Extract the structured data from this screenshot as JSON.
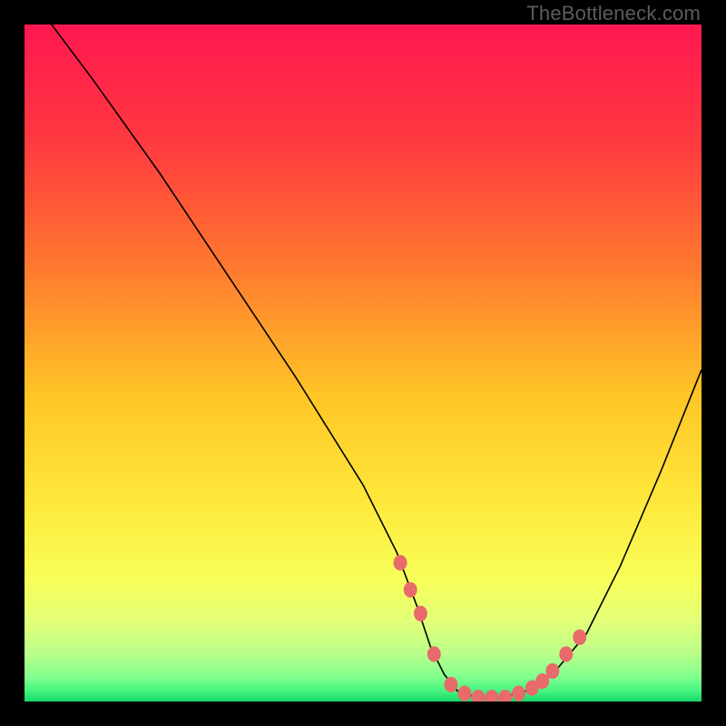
{
  "watermark": "TheBottleneck.com",
  "chart_data": {
    "type": "line",
    "title": "",
    "xlabel": "",
    "ylabel": "",
    "xlim": [
      0,
      100
    ],
    "ylim": [
      0,
      100
    ],
    "grid": false,
    "legend": false,
    "curve": {
      "x": [
        4,
        10,
        20,
        30,
        40,
        50,
        55,
        58,
        60,
        62,
        64,
        67,
        70,
        74,
        78,
        83,
        88,
        94,
        100
      ],
      "y": [
        100,
        92,
        78,
        63,
        48,
        32,
        22,
        14,
        8,
        4,
        1.5,
        0.5,
        0.5,
        1.5,
        4,
        10,
        20,
        34,
        49
      ]
    },
    "markers": {
      "x": [
        55.5,
        57.0,
        58.5,
        60.5,
        63.0,
        65.0,
        67.0,
        69.0,
        71.0,
        73.0,
        75.0,
        76.5,
        78.0,
        80.0,
        82.0
      ],
      "y": [
        20.5,
        16.5,
        13.0,
        7.0,
        2.5,
        1.2,
        0.6,
        0.6,
        0.6,
        1.2,
        2.0,
        3.0,
        4.5,
        7.0,
        9.5
      ]
    },
    "gradient_stops": [
      {
        "t": 0.0,
        "c": "#ff1750"
      },
      {
        "t": 0.18,
        "c": "#ff3b3f"
      },
      {
        "t": 0.36,
        "c": "#ff7a2f"
      },
      {
        "t": 0.55,
        "c": "#ffc626"
      },
      {
        "t": 0.7,
        "c": "#ffe73a"
      },
      {
        "t": 0.82,
        "c": "#f7ff58"
      },
      {
        "t": 0.88,
        "c": "#e3ff77"
      },
      {
        "t": 0.93,
        "c": "#b9ff8a"
      },
      {
        "t": 0.965,
        "c": "#7fff8e"
      },
      {
        "t": 0.985,
        "c": "#43f47f"
      },
      {
        "t": 1.0,
        "c": "#15d86a"
      }
    ],
    "marker_color": "#e86a6a",
    "line_color": "#000000"
  }
}
